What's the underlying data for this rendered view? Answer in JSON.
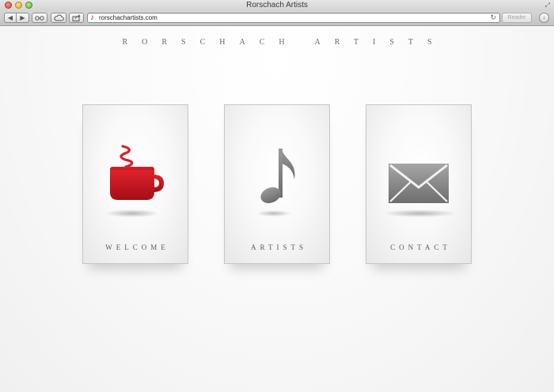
{
  "window": {
    "title": "Rorschach Artists"
  },
  "toolbar": {
    "back_icon": "back-arrow-icon",
    "forward_icon": "forward-arrow-icon",
    "reading_list_icon": "glasses-icon",
    "icloud_icon": "cloud-icon",
    "share_icon": "share-icon",
    "url": "rorschachartists.com",
    "reader_label": "Reader",
    "reload_icon": "reload-icon",
    "downloads_icon": "download-icon"
  },
  "page": {
    "site_title": "RORSCHACH ARTISTS",
    "cards": [
      {
        "label": "WELCOME",
        "icon": "coffee-cup-icon",
        "icon_color": "#c5141f"
      },
      {
        "label": "ARTISTS",
        "icon": "music-note-icon",
        "icon_color": "#8a8a8a"
      },
      {
        "label": "CONTACT",
        "icon": "envelope-icon",
        "icon_color": "#8a8a8a"
      }
    ]
  },
  "colors": {
    "accent_red": "#c5141f",
    "icon_gray": "#8a8a8a",
    "text_gray": "#5a5a5a"
  }
}
